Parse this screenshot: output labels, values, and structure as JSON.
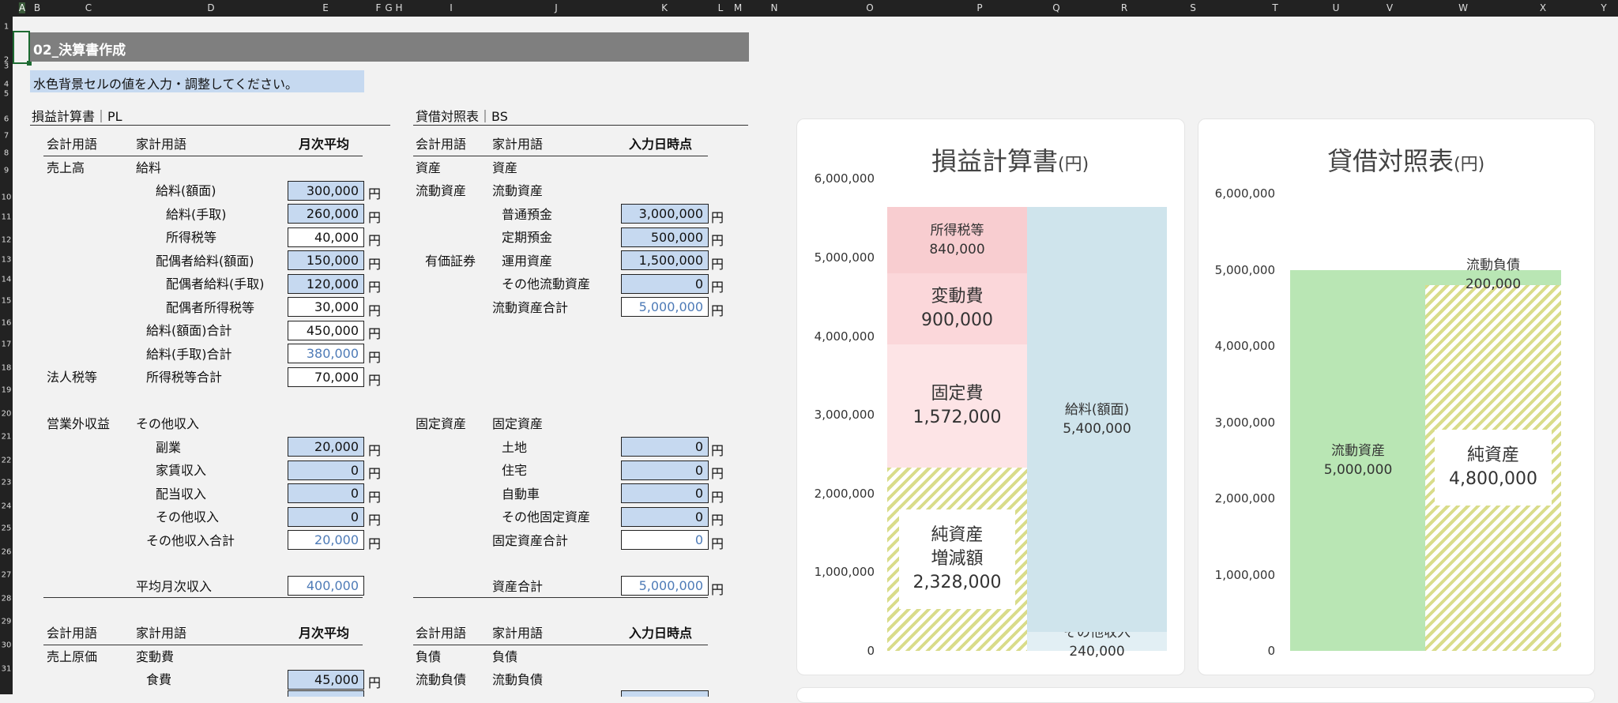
{
  "sheet": {
    "columns": [
      "A",
      "B",
      "C",
      "D",
      "E",
      "F",
      "G",
      "H",
      "I",
      "J",
      "K",
      "L",
      "M",
      "N",
      "O",
      "P",
      "Q",
      "R",
      "S",
      "T",
      "U",
      "V",
      "W",
      "X",
      "Y"
    ],
    "rows": [
      "1",
      "2",
      "3",
      "4",
      "5",
      "6",
      "7",
      "8",
      "9",
      "10",
      "11",
      "12",
      "13",
      "14",
      "15",
      "16",
      "17",
      "18",
      "19",
      "20",
      "21",
      "22",
      "23",
      "24",
      "25",
      "26",
      "27",
      "28",
      "29",
      "30",
      "31"
    ],
    "title": "02_決算書作成",
    "note": "水色背景セルの値を入力・調整してください。",
    "unit": "円",
    "pl": {
      "section": "損益計算書｜PL",
      "h_acc": "会計用語",
      "h_home": "家計用語",
      "h_val": "月次平均",
      "r_sales_acc": "売上高",
      "r_sales_home": "給料",
      "items": [
        {
          "label": "給料(額面)",
          "value": "300,000"
        },
        {
          "label": "給料(手取)",
          "value": "260,000"
        },
        {
          "label": "所得税等",
          "value": "40,000"
        },
        {
          "label": "配偶者給料(額面)",
          "value": "150,000"
        },
        {
          "label": "配偶者給料(手取)",
          "value": "120,000"
        },
        {
          "label": "配偶者所得税等",
          "value": "30,000"
        },
        {
          "label": "給料(額面)合計",
          "value": "450,000"
        },
        {
          "label": "給料(手取)合計",
          "value": "380,000"
        },
        {
          "label": "所得税等合計",
          "value": "70,000"
        }
      ],
      "tax_acc": "法人税等",
      "other_acc": "営業外収益",
      "other_home": "その他収入",
      "other_items": [
        {
          "label": "副業",
          "value": "20,000"
        },
        {
          "label": "家賃収入",
          "value": "0"
        },
        {
          "label": "配当収入",
          "value": "0"
        },
        {
          "label": "その他収入",
          "value": "0"
        },
        {
          "label": "その他収入合計",
          "value": "20,000"
        }
      ],
      "avg_label": "平均月次収入",
      "avg_value": "400,000",
      "h2_acc": "会計用語",
      "h2_home": "家計用語",
      "h2_val": "月次平均",
      "cogs_acc": "売上原価",
      "cogs_home": "変動費",
      "food_label": "食費",
      "food_value": "45,000"
    },
    "bs": {
      "section": "貸借対照表｜BS",
      "h_acc": "会計用語",
      "h_home": "家計用語",
      "h_val": "入力日時点",
      "asset_acc": "資産",
      "asset_home": "資産",
      "cur_acc": "流動資産",
      "cur_home": "流動資産",
      "cur_items": [
        {
          "label": "普通預金",
          "value": "3,000,000"
        },
        {
          "label": "定期預金",
          "value": "500,000"
        },
        {
          "label": "運用資産",
          "value": "1,500,000"
        },
        {
          "label": "その他流動資産",
          "value": "0"
        },
        {
          "label": "流動資産合計",
          "value": "5,000,000"
        }
      ],
      "sec_acc": "有価証券",
      "fix_acc": "固定資産",
      "fix_home": "固定資産",
      "fix_items": [
        {
          "label": "土地",
          "value": "0"
        },
        {
          "label": "住宅",
          "value": "0"
        },
        {
          "label": "自動車",
          "value": "0"
        },
        {
          "label": "その他固定資産",
          "value": "0"
        },
        {
          "label": "固定資産合計",
          "value": "0"
        }
      ],
      "total_label": "資産合計",
      "total_value": "5,000,000",
      "h2_acc": "会計用語",
      "h2_home": "家計用語",
      "h2_val": "入力日時点",
      "liab_acc": "負債",
      "liab_home": "負債",
      "cl_acc": "流動負債",
      "cl_home": "流動負債"
    }
  },
  "chart_data": [
    {
      "type": "bar",
      "title": "損益計算書",
      "title_unit": "(円)",
      "ylim": [
        0,
        6000000
      ],
      "yticks": [
        "6,000,000",
        "5,000,000",
        "4,000,000",
        "3,000,000",
        "2,000,000",
        "1,000,000",
        "0"
      ],
      "series": [
        {
          "name": "純資産 増減額",
          "stack": "left",
          "value": 2328000,
          "label1": "純資産",
          "label2": "増減額",
          "label3": "2,328,000",
          "color": "#d9dc8a"
        },
        {
          "name": "固定費",
          "stack": "left",
          "value": 1572000,
          "label1": "固定費",
          "label3": "1,572,000",
          "color": "#fde4e6"
        },
        {
          "name": "変動費",
          "stack": "left",
          "value": 900000,
          "label1": "変動費",
          "label3": "900,000",
          "color": "#fbd7da"
        },
        {
          "name": "所得税等",
          "stack": "left",
          "value": 840000,
          "label1": "所得税等",
          "label3": "840,000",
          "color": "#f8cdd0"
        },
        {
          "name": "その他収入",
          "stack": "right",
          "value": 240000,
          "label1": "その他収入",
          "label3": "240,000",
          "color": "#e2eff4"
        },
        {
          "name": "給料(額面)",
          "stack": "right",
          "value": 5400000,
          "label1": "給料(額面)",
          "label3": "5,400,000",
          "color": "#cfe4ec"
        }
      ]
    },
    {
      "type": "bar",
      "title": "貸借対照表",
      "title_unit": "(円)",
      "ylim": [
        0,
        5000000
      ],
      "yticks": [
        "6,000,000",
        "5,000,000",
        "4,000,000",
        "3,000,000",
        "2,000,000",
        "1,000,000",
        "0"
      ],
      "series": [
        {
          "name": "流動資産",
          "stack": "left",
          "value": 5000000,
          "label1": "流動資産",
          "label3": "5,000,000",
          "color": "#b9e6b4"
        },
        {
          "name": "純資産",
          "stack": "right",
          "value": 4800000,
          "label1": "純資産",
          "label3": "4,800,000",
          "color": "#d9dc8a"
        },
        {
          "name": "流動負債",
          "stack": "right",
          "value": 200000,
          "label1": "流動負債",
          "label3": "200,000",
          "color": "#b9e6b4"
        }
      ]
    }
  ]
}
